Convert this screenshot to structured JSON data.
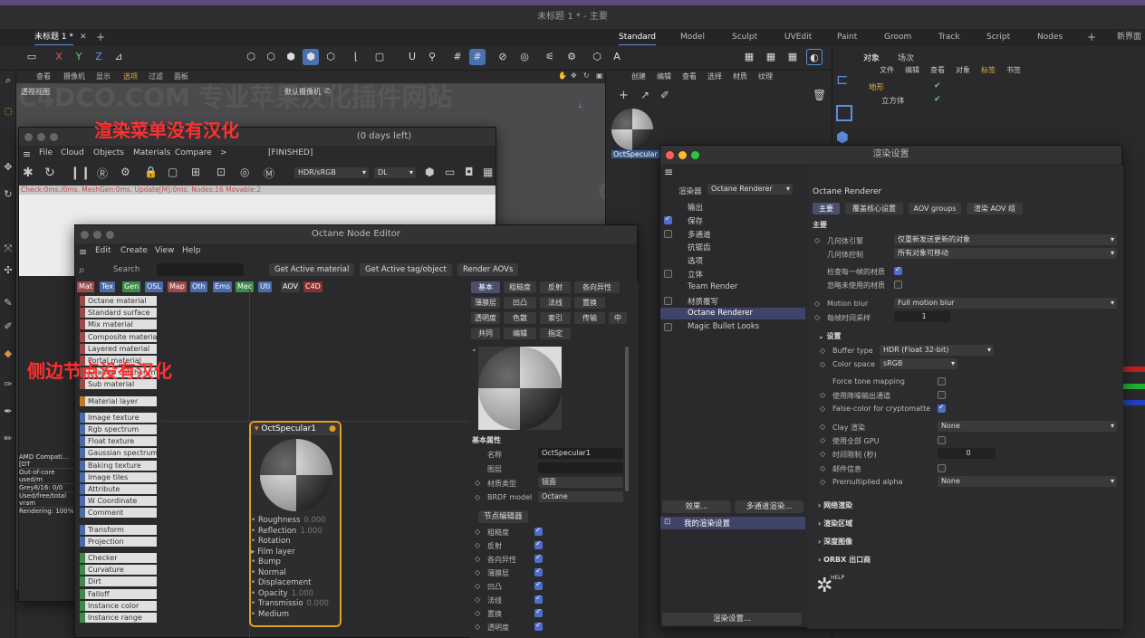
{
  "window_title": "未标题 1 * - 主要",
  "doc_tab": "未标题 1 *",
  "layouts": [
    "Standard",
    "Model",
    "Sculpt",
    "UVEdit",
    "Paint",
    "Groom",
    "Track",
    "Script",
    "Nodes"
  ],
  "new_layout": "新界面",
  "viewport_menu": [
    "查看",
    "摄像机",
    "显示",
    "选项",
    "过滤",
    "面板"
  ],
  "viewport_label": "透视视图",
  "camera_label": "默认摄像机",
  "material_menu": [
    "创建",
    "编辑",
    "查看",
    "选择",
    "材质",
    "纹理"
  ],
  "material_name": "OctSpecular",
  "object_tabs": [
    "对象",
    "场次"
  ],
  "object_menu": [
    "文件",
    "编辑",
    "查看",
    "对象",
    "标签",
    "书签"
  ],
  "objects": [
    "地形",
    "立方体"
  ],
  "annotations": {
    "render_menu": "渲染菜单没有汉化",
    "side_nodes": "侧边节点没有汉化"
  },
  "watermark": "C4DCO.COM 专业苹果汉化插件网站",
  "live_viewer": {
    "title": "(0 days left)",
    "menu": [
      "File",
      "Cloud",
      "Objects",
      "Materials",
      "Compare",
      ">"
    ],
    "status": "[FINISHED]",
    "color_mode": "HDR/sRGB",
    "mode": "DL",
    "info": "Check:0ms./0ms. MeshGen:0ms. Update[M]:0ms. Nodes:16 Movable:2",
    "side_stats": [
      "AMD Compati... [DT",
      "Out-of-core used/m",
      "Grey8/16: 0/0",
      "Used/free/total vram",
      "Rendering: 100%"
    ]
  },
  "node_editor": {
    "title": "Octane Node Editor",
    "menu": [
      "Edit",
      "Create",
      "View",
      "Help"
    ],
    "search": "Search",
    "buttons": [
      "Get Active material",
      "Get Active tag/object",
      "Render AOVs"
    ],
    "categories": [
      {
        "label": "Mat",
        "color": "#a04848"
      },
      {
        "label": "Tex",
        "color": "#4a6aa8"
      },
      {
        "label": "Gen",
        "color": "#3f8a4a"
      },
      {
        "label": "OSL",
        "color": "#4a6aa8"
      },
      {
        "label": "Map",
        "color": "#a04848"
      },
      {
        "label": "Oth",
        "color": "#4a6aa8"
      },
      {
        "label": "Ems",
        "color": "#4a6aa8"
      },
      {
        "label": "Mec",
        "color": "#3f8a4a"
      },
      {
        "label": "Uti",
        "color": "#4a6aa8"
      },
      {
        "label": "AOV",
        "color": "#3a3a3a"
      },
      {
        "label": "C4D",
        "color": "#8a3030"
      }
    ],
    "nodes": [
      {
        "label": "Octane material",
        "color": "#9b4949"
      },
      {
        "label": "Standard surface",
        "color": "#9b4949"
      },
      {
        "label": "Mix material",
        "color": "#9b4949"
      },
      {
        "label": "Composite material",
        "color": "#9b4949"
      },
      {
        "label": "Layered material",
        "color": "#9b4949"
      },
      {
        "label": "Portal material",
        "color": "#9b4949"
      },
      {
        "label": "Shadow catcher m",
        "color": "#9b4949"
      },
      {
        "label": "Sub material",
        "color": "#9b4949"
      },
      {
        "label": "Material layer",
        "color": "#c07a2a"
      },
      {
        "label": "Image texture",
        "color": "#4a6aa8"
      },
      {
        "label": "Rgb spectrum",
        "color": "#4a6aa8"
      },
      {
        "label": "Float texture",
        "color": "#4a6aa8"
      },
      {
        "label": "Gaussian spectrum",
        "color": "#4a6aa8"
      },
      {
        "label": "Baking texture",
        "color": "#4a6aa8"
      },
      {
        "label": "Image tiles",
        "color": "#4a6aa8"
      },
      {
        "label": "Attribute",
        "color": "#4a6aa8"
      },
      {
        "label": "W Coordinate",
        "color": "#4a6aa8"
      },
      {
        "label": "Comment",
        "color": "#4a6aa8"
      },
      {
        "label": "Transform",
        "color": "#4a6aa8"
      },
      {
        "label": "Projection",
        "color": "#4a6aa8"
      },
      {
        "label": "Checker",
        "color": "#3f8a4a"
      },
      {
        "label": "Curvature",
        "color": "#3f8a4a"
      },
      {
        "label": "Dirt",
        "color": "#3f8a4a"
      },
      {
        "label": "Falloff",
        "color": "#3f8a4a"
      },
      {
        "label": "Instance color",
        "color": "#3f8a4a"
      },
      {
        "label": "Instance range",
        "color": "#3f8a4a"
      }
    ],
    "node": {
      "name": "OctSpecular1",
      "ports": [
        {
          "label": "Roughness",
          "value": "0.000"
        },
        {
          "label": "Reflection",
          "value": "1.000"
        },
        {
          "label": "Rotation",
          "value": ""
        },
        {
          "label": "Film layer",
          "value": ""
        },
        {
          "label": "Bump",
          "value": ""
        },
        {
          "label": "Normal",
          "value": ""
        },
        {
          "label": "Displacement",
          "value": ""
        },
        {
          "label": "Opacity",
          "value": "1.000"
        },
        {
          "label": "Transmissio",
          "value": "0.000"
        },
        {
          "label": "Medium",
          "value": ""
        }
      ]
    },
    "prop_tabs": [
      "基本",
      "粗糙度",
      "反射",
      "各向异性",
      "薄膜层",
      "凹凸",
      "法线",
      "置换",
      "透明度",
      "色散",
      "索引",
      "传输",
      "中",
      "共同",
      "编辑",
      "指定"
    ],
    "basic_header": "基本属性",
    "name_label": "名称",
    "name_value": "OctSpecular1",
    "layer_label": "图层",
    "mat_type_label": "材质类型",
    "mat_type_value": "镜面",
    "brdf_label": "BRDF model",
    "brdf_value": "Octane",
    "node_editor_btn": "节点编辑器",
    "channels": [
      "粗糙度",
      "反射",
      "各向异性",
      "薄膜层",
      "凹凸",
      "法线",
      "置换",
      "透明度"
    ]
  },
  "render_settings": {
    "title": "渲染设置",
    "renderer_label": "渲染器",
    "renderer_value": "Octane Renderer",
    "items": [
      {
        "label": "输出",
        "check": false,
        "box": false
      },
      {
        "label": "保存",
        "check": true,
        "box": true
      },
      {
        "label": "多通道",
        "check": false,
        "box": true
      },
      {
        "label": "抗锯齿",
        "check": false,
        "box": false
      },
      {
        "label": "选项",
        "check": false,
        "box": false
      },
      {
        "label": "立体",
        "check": false,
        "box": true
      },
      {
        "label": "Team Render",
        "check": false,
        "box": false
      },
      {
        "label": "材质覆写",
        "check": false,
        "box": true
      },
      {
        "label": "Octane Renderer",
        "check": false,
        "box": false,
        "selected": true
      },
      {
        "label": "Magic Bullet Looks",
        "check": false,
        "box": true
      }
    ],
    "effects_btn": "效果...",
    "multipass_btn": "多通道渲染...",
    "my_settings": "我的渲染设置",
    "settings_btn": "渲染设置...",
    "panel_title": "Octane Renderer",
    "tabs": [
      "主要",
      "覆盖核心设置",
      "AOV groups",
      "渲染 AOV 组"
    ],
    "main_header": "主要",
    "geom_engine_label": "几何体引擎",
    "geom_engine_value": "仅重新发送更新的对象",
    "geom_ctrl_label": "几何体控制",
    "geom_ctrl_value": "所有对象可移动",
    "check_each_label": "检查每一帧的材质",
    "ignore_unused_label": "忽略未使用的材质",
    "motion_blur_label": "Motion blur",
    "motion_blur_value": "Full motion blur",
    "frame_sample_label": "每帧时间采样",
    "frame_sample_value": "1",
    "settings_header": "设置",
    "buffer_label": "Buffer type",
    "buffer_value": "HDR (Float 32-bit)",
    "color_space_label": "Color space",
    "color_space_value": "sRGB",
    "force_tone_label": "Force tone mapping",
    "denoise_label": "使用降噪输出通道",
    "false_color_label": "False-color for cryptomatte",
    "clay_label": "Clay 渲染",
    "clay_value": "None",
    "all_gpu_label": "使用全部 GPU",
    "time_limit_label": "时间限制 (秒)",
    "time_limit_value": "0",
    "mail_label": "邮件信息",
    "premult_label": "Premultiplied alpha",
    "premult_value": "None",
    "sections": [
      "网络渲染",
      "渲染区域",
      "深度图像",
      "ORBX 出口商"
    ],
    "help": "HELP"
  }
}
